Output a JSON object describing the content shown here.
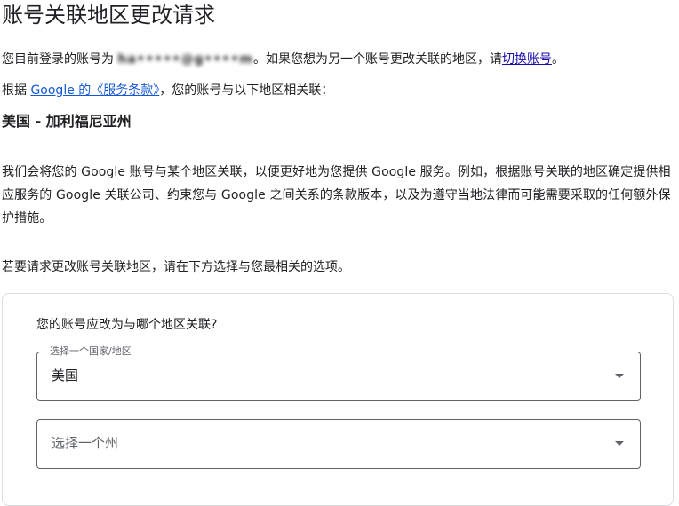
{
  "page_title": "账号关联地区更改请求",
  "intro": {
    "prefix": "您目前登录的账号为 ",
    "email_masked": "ha•••••@g••••m",
    "middle": "。如果您想为另一个账号更改关联的地区，请",
    "switch_link": "切换账号",
    "suffix": "。"
  },
  "terms_line": {
    "prefix": "根据 ",
    "link": "Google 的《服务条款》",
    "suffix": "，您的账号与以下地区相关联："
  },
  "current_region": "美国 - 加利福尼亚州",
  "description": "我们会将您的 Google 账号与某个地区关联，以便更好地为您提供 Google 服务。例如，根据账号关联的地区确定提供相应服务的 Google 关联公司、约束您与 Google 之间关系的条款版本，以及为遵守当地法律而可能需要采取的任何额外保护措施。",
  "instruction": "若要请求更改账号关联地区，请在下方选择与您最相关的选项。",
  "form": {
    "question": "您的账号应改为与哪个地区关联?",
    "country_select": {
      "label": "选择一个国家/地区",
      "value": "美国"
    },
    "state_select": {
      "placeholder": "选择一个州"
    }
  }
}
